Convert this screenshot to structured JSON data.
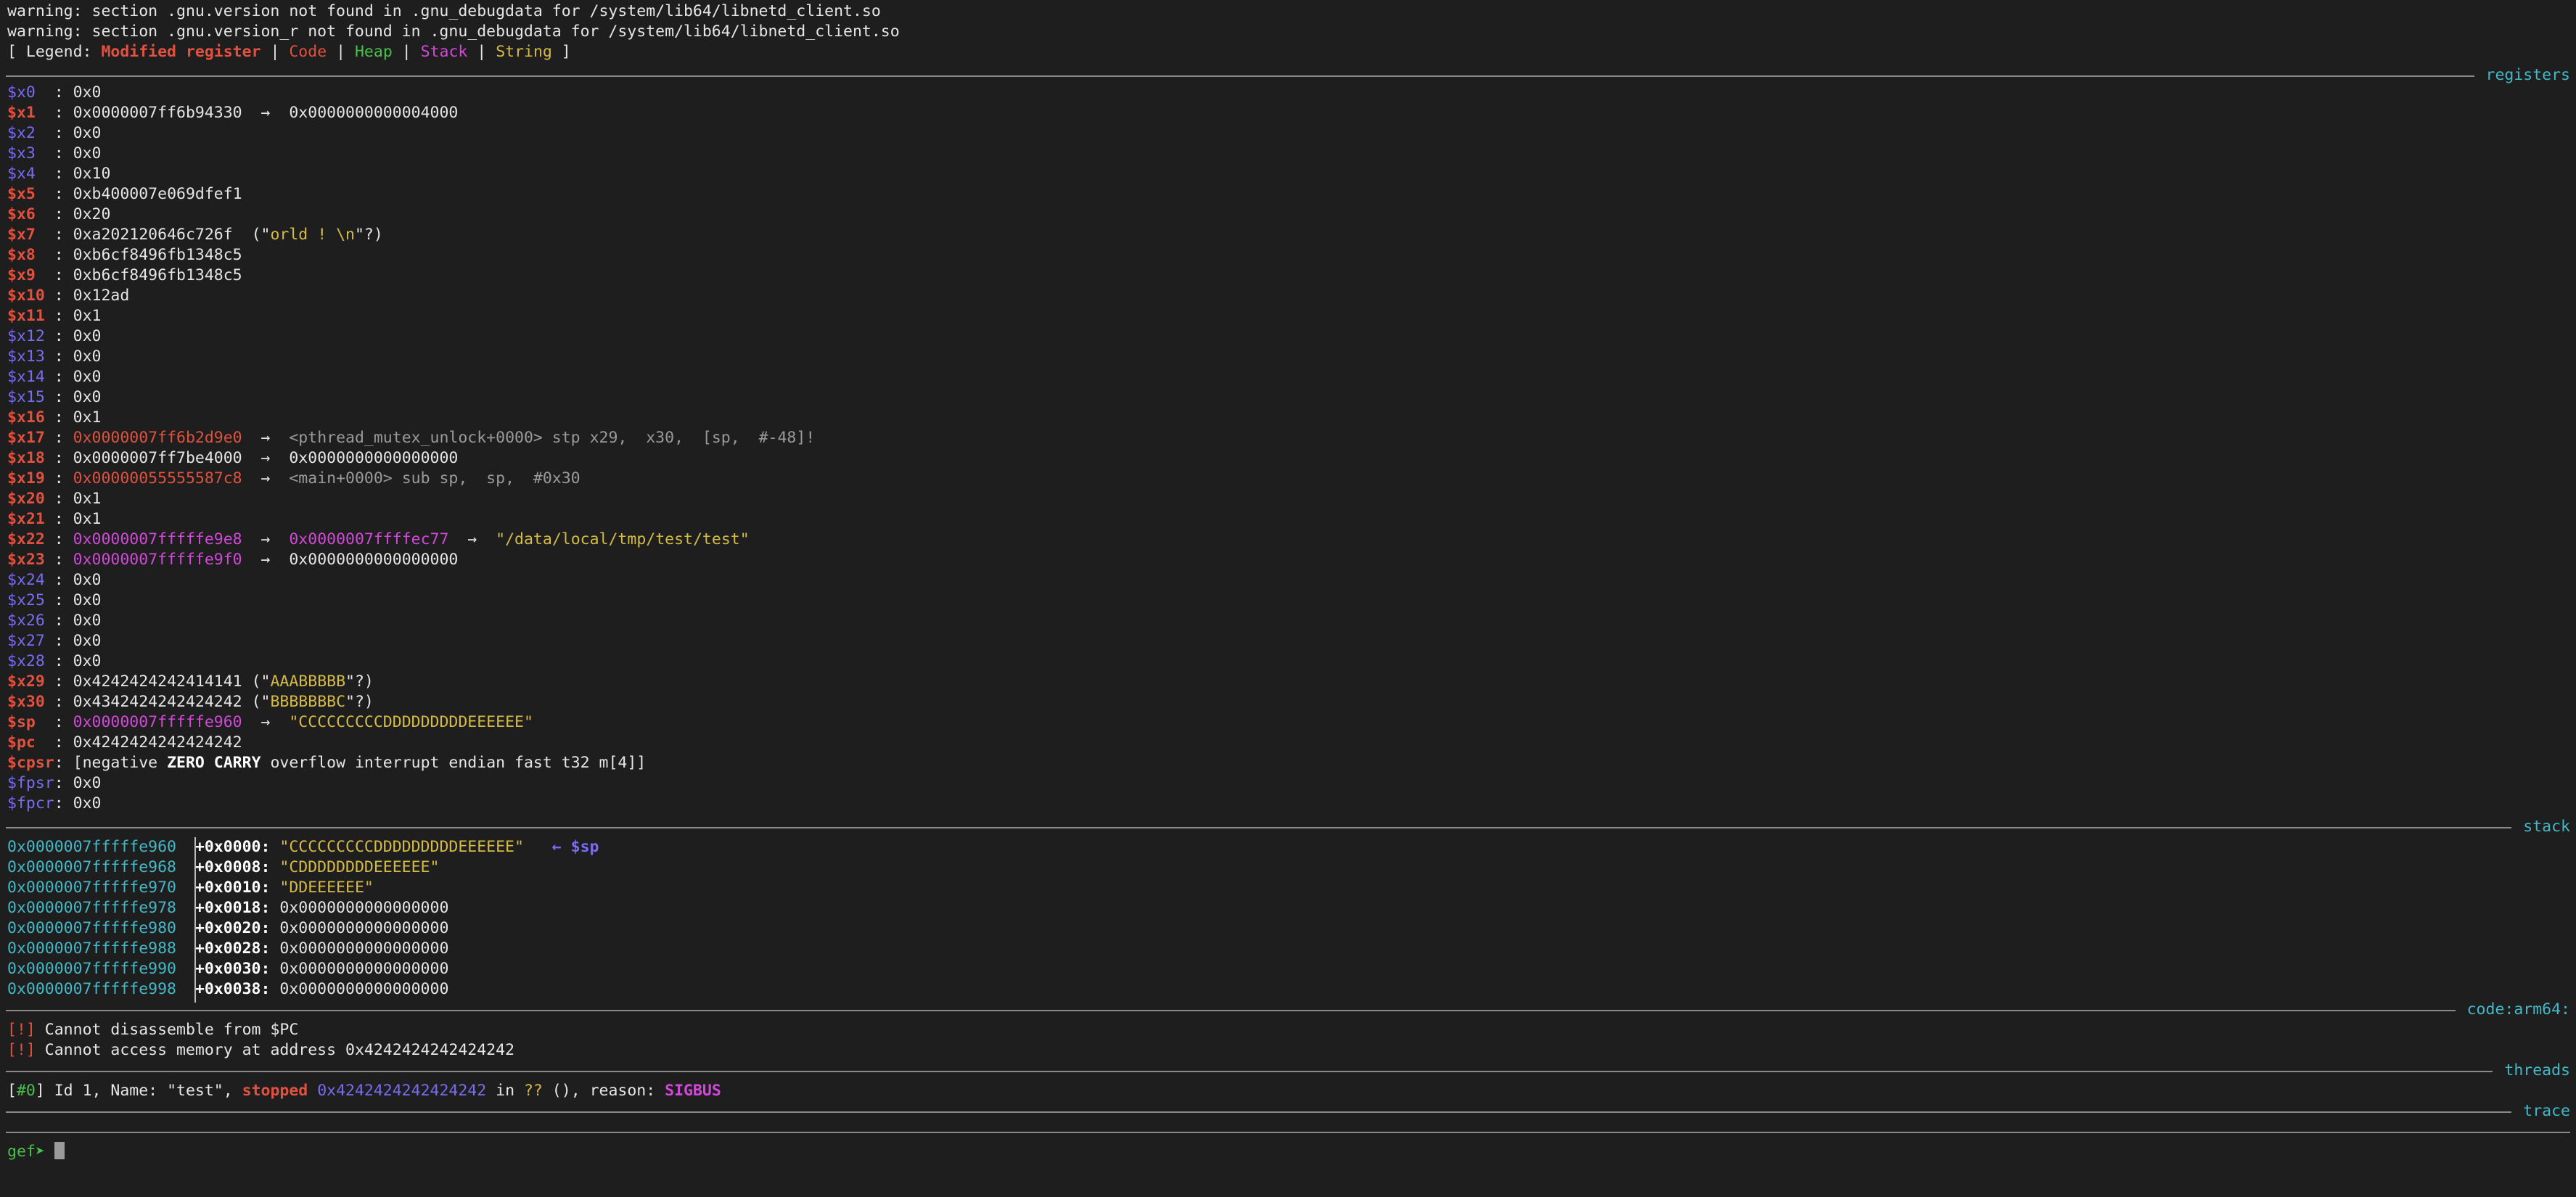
{
  "warnings": [
    "warning: section .gnu.version not found in .gnu_debugdata for /system/lib64/libnetd_client.so",
    "warning: section .gnu.version_r not found in .gnu_debugdata for /system/lib64/libnetd_client.so"
  ],
  "legend": {
    "prefix": "[ Legend: ",
    "modified": "Modified register",
    "code": "Code",
    "heap": "Heap",
    "stack": "Stack",
    "string": "String",
    "sep": " | ",
    "suffix": " ]"
  },
  "sections": {
    "registers": "registers",
    "stack": "stack",
    "code": "code:arm64:",
    "threads": "threads",
    "trace": "trace"
  },
  "registers": [
    {
      "name": "$x0  ",
      "value": "0x0"
    },
    {
      "name": "$x1  ",
      "value": "0x0000007ff6b94330",
      "arrow": "→",
      "deref": "0x0000000000004000"
    },
    {
      "name": "$x2  ",
      "value": "0x0"
    },
    {
      "name": "$x3  ",
      "value": "0x0"
    },
    {
      "name": "$x4  ",
      "value": "0x10"
    },
    {
      "name": "$x5  ",
      "value": "0xb400007e069dfef1"
    },
    {
      "name": "$x6  ",
      "value": "0x20"
    },
    {
      "name": "$x7  ",
      "value": "0xa202120646c726f",
      "str_pre": "(\"",
      "str": "orld ! \\n",
      "str_post": "\"?)"
    },
    {
      "name": "$x8  ",
      "value": "0xb6cf8496fb1348c5"
    },
    {
      "name": "$x9  ",
      "value": "0xb6cf8496fb1348c5"
    },
    {
      "name": "$x10 ",
      "value": "0x12ad"
    },
    {
      "name": "$x11 ",
      "value": "0x1"
    },
    {
      "name": "$x12 ",
      "value": "0x0"
    },
    {
      "name": "$x13 ",
      "value": "0x0"
    },
    {
      "name": "$x14 ",
      "value": "0x0"
    },
    {
      "name": "$x15 ",
      "value": "0x0"
    },
    {
      "name": "$x16 ",
      "value": "0x1"
    },
    {
      "name": "$x17 ",
      "value": "0x0000007ff6b2d9e0",
      "arrow": "→",
      "code": "<pthread_mutex_unlock+0000> stp x29,  x30,  [sp,  #-48]!"
    },
    {
      "name": "$x18 ",
      "value": "0x0000007ff7be4000",
      "arrow": "→",
      "deref": "0x0000000000000000"
    },
    {
      "name": "$x19 ",
      "value": "0x00000055555587c8",
      "arrow": "→",
      "code": "<main+0000> sub sp,  sp,  #0x30"
    },
    {
      "name": "$x20 ",
      "value": "0x1"
    },
    {
      "name": "$x21 ",
      "value": "0x1"
    },
    {
      "name": "$x22 ",
      "value": "0x0000007fffffe9e8",
      "arrow": "→",
      "deref": "0x0000007ffffec77",
      "arrow2": "→",
      "str": "\"/data/local/tmp/test/test\""
    },
    {
      "name": "$x23 ",
      "value": "0x0000007fffffe9f0",
      "arrow": "→",
      "deref": "0x0000000000000000"
    },
    {
      "name": "$x24 ",
      "value": "0x0"
    },
    {
      "name": "$x25 ",
      "value": "0x0"
    },
    {
      "name": "$x26 ",
      "value": "0x0"
    },
    {
      "name": "$x27 ",
      "value": "0x0"
    },
    {
      "name": "$x28 ",
      "value": "0x0"
    },
    {
      "name": "$x29 ",
      "value": "0x4242424242414141",
      "str_pre": " (\"",
      "str": "AAABBBBB",
      "str_post": "\"?)"
    },
    {
      "name": "$x30 ",
      "value": "0x4342424242424242",
      "str_pre": " (\"",
      "str": "BBBBBBBC",
      "str_post": "\"?)"
    },
    {
      "name": "$sp  ",
      "value": "0x0000007fffffe960",
      "arrow": "→",
      "str": "\"CCCCCCCCCDDDDDDDDDEEEEEE\""
    },
    {
      "name": "$pc  ",
      "value": "0x4242424242424242"
    },
    {
      "name": "$cpsr",
      "flags_pre": "[negative ",
      "flags_bold": "ZERO CARRY",
      "flags_post": " overflow interrupt endian fast t32 m[4]]"
    },
    {
      "name": "$fpsr",
      "value": "0x0"
    },
    {
      "name": "$fpcr",
      "value": "0x0"
    }
  ],
  "stack": [
    {
      "addr": "0x0000007fffffe960",
      "off": "+0x0000: ",
      "val": "\"CCCCCCCCCDDDDDDDDDEEEEEE\"",
      "marker": "← $sp"
    },
    {
      "addr": "0x0000007fffffe968",
      "off": "+0x0008: ",
      "val": "\"CDDDDDDDDEEEEEE\""
    },
    {
      "addr": "0x0000007fffffe970",
      "off": "+0x0010: ",
      "val": "\"DDEEEEEE\""
    },
    {
      "addr": "0x0000007fffffe978",
      "off": "+0x0018: ",
      "val": "0x0000000000000000"
    },
    {
      "addr": "0x0000007fffffe980",
      "off": "+0x0020: ",
      "val": "0x0000000000000000"
    },
    {
      "addr": "0x0000007fffffe988",
      "off": "+0x0028: ",
      "val": "0x0000000000000000"
    },
    {
      "addr": "0x0000007fffffe990",
      "off": "+0x0030: ",
      "val": "0x0000000000000000"
    },
    {
      "addr": "0x0000007fffffe998",
      "off": "+0x0038: ",
      "val": "0x0000000000000000"
    }
  ],
  "code_errors": [
    {
      "tag": "[!]",
      "text": " Cannot disassemble from $PC"
    },
    {
      "tag": "[!]",
      "text": " Cannot access memory at address 0x4242424242424242"
    }
  ],
  "thread": {
    "open": "[",
    "id": "#0",
    "close": "]",
    "info": " Id 1, Name: \"test\", ",
    "state": "stopped",
    "addr": "0x4242424242424242",
    "in": " in ",
    "func": "??",
    "rest": " (), reason: ",
    "reason": "SIGBUS"
  },
  "prompt": "gef➤ "
}
